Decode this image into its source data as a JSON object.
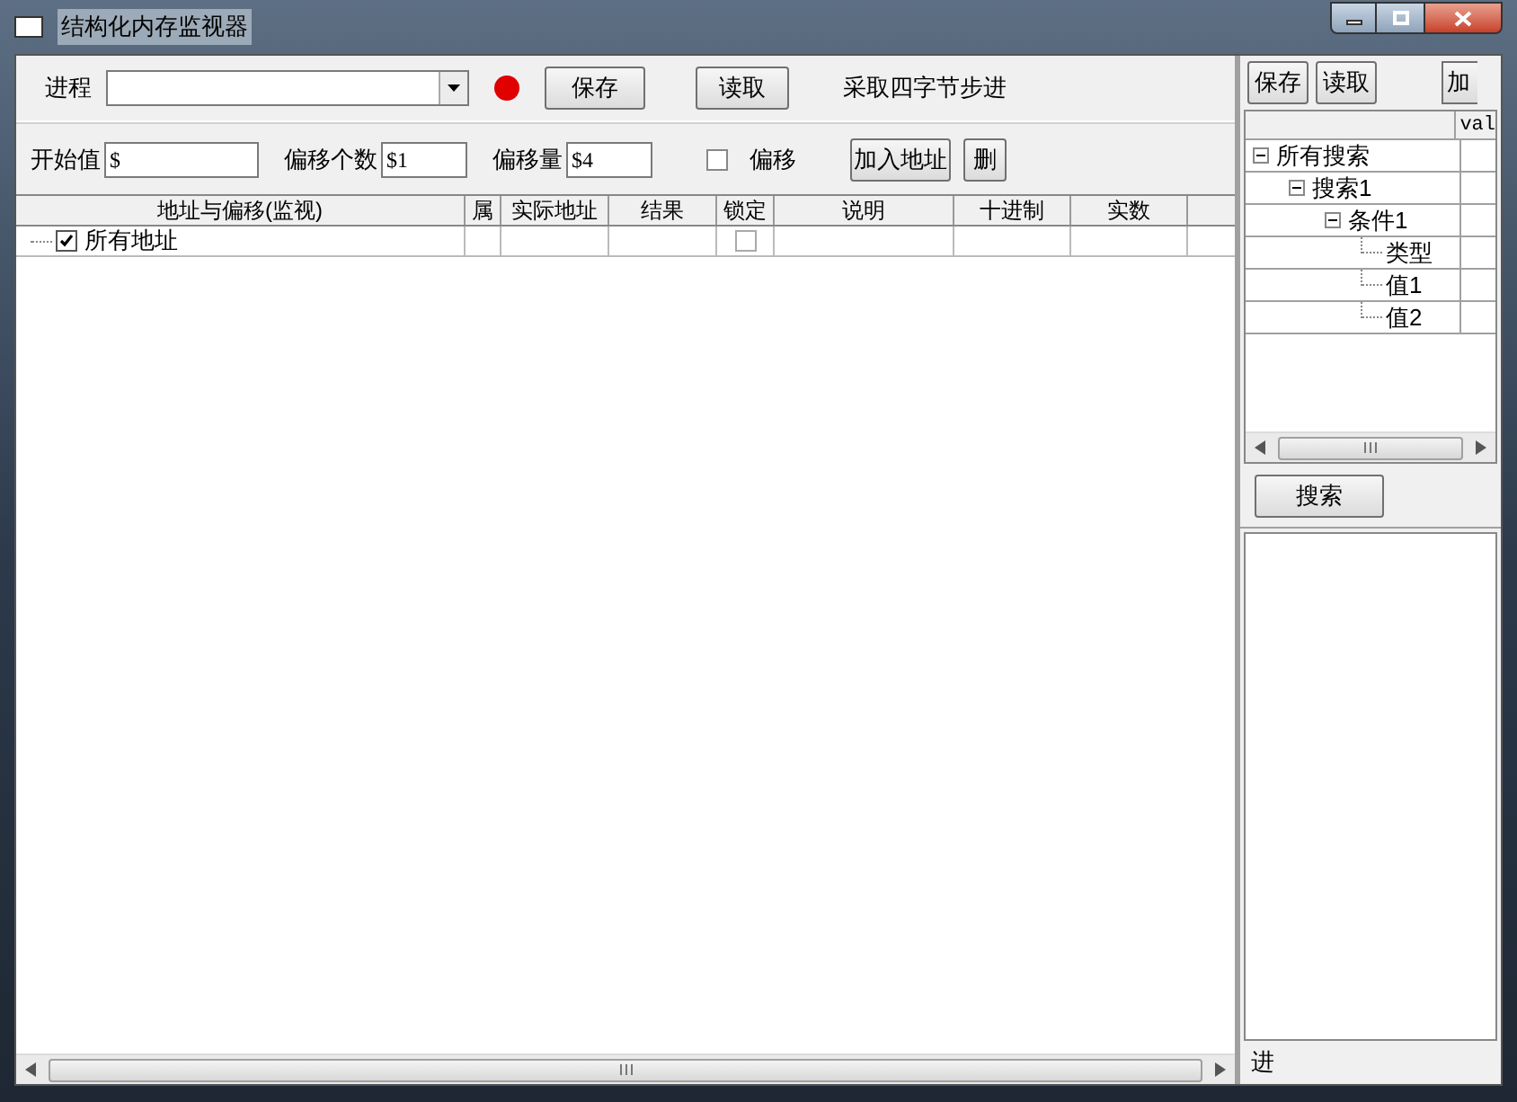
{
  "window": {
    "title": "结构化内存监视器"
  },
  "toolbar": {
    "process_label": "进程",
    "buttons": [
      "保存",
      "读取"
    ],
    "note": "采取四字节步进"
  },
  "offset_bar": {
    "fields": [
      {
        "label": "开始值",
        "value": "$"
      },
      {
        "label": "偏移个数",
        "value": "$1"
      },
      {
        "label": "偏移量",
        "value": "$4"
      }
    ],
    "checkbox": {
      "label": "偏移",
      "checked": false
    },
    "buttons": [
      "加入地址",
      "删"
    ]
  },
  "table": {
    "columns": [
      "地址与偏移(监视)",
      "属",
      "实际地址",
      "结果",
      "锁定",
      "说明",
      "十进制",
      "实数"
    ],
    "rows": [
      {
        "label": "所有地址",
        "checked": true,
        "locked": false
      }
    ]
  },
  "right_panel": {
    "buttons": [
      "保存",
      "读取",
      "加"
    ],
    "tree_header": "val",
    "tree": [
      {
        "label": "所有搜索",
        "expanded": true,
        "children": [
          {
            "label": "搜索1",
            "expanded": true,
            "children": [
              {
                "label": "条件1",
                "expanded": true,
                "children": [
                  {
                    "label": "类型"
                  },
                  {
                    "label": "值1"
                  },
                  {
                    "label": "值2"
                  }
                ]
              }
            ]
          }
        ]
      }
    ],
    "search_button": "搜索",
    "bottom_label": "进"
  }
}
